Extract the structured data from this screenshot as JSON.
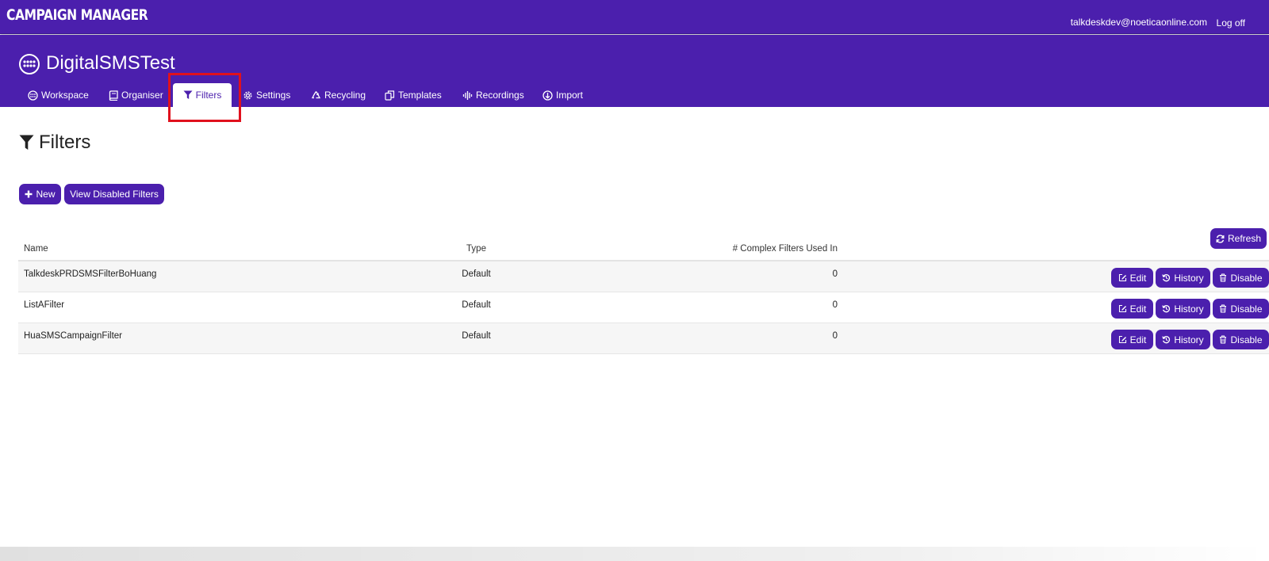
{
  "app": {
    "brand": "CAMPAIGN MANAGER",
    "user_email": "talkdeskdev@noeticaonline.com",
    "logoff_label": "Log off"
  },
  "project": {
    "title": "DigitalSMSTest"
  },
  "tabs": [
    {
      "label": "Workspace",
      "icon": "workspace-icon"
    },
    {
      "label": "Organiser",
      "icon": "book-icon"
    },
    {
      "label": "Filters",
      "icon": "filter-icon",
      "active": true
    },
    {
      "label": "Settings",
      "icon": "gear-icon"
    },
    {
      "label": "Recycling",
      "icon": "recycle-icon"
    },
    {
      "label": "Templates",
      "icon": "copy-icon"
    },
    {
      "label": "Recordings",
      "icon": "audio-icon"
    },
    {
      "label": "Import",
      "icon": "import-icon"
    }
  ],
  "page": {
    "heading": "Filters",
    "new_label": "New",
    "view_disabled_label": "View Disabled Filters",
    "refresh_label": "Refresh"
  },
  "table": {
    "columns": [
      "Name",
      "Type",
      "# Complex Filters Used In"
    ],
    "rows": [
      {
        "name": "TalkdeskPRDSMSFilterBoHuang",
        "type": "Default",
        "count": "0"
      },
      {
        "name": "ListAFilter",
        "type": "Default",
        "count": "0"
      },
      {
        "name": "HuaSMSCampaignFilter",
        "type": "Default",
        "count": "0"
      }
    ],
    "actions": {
      "edit": "Edit",
      "history": "History",
      "disable": "Disable"
    }
  },
  "colors": {
    "primary": "#4b1fad",
    "highlight": "#e0111d"
  }
}
